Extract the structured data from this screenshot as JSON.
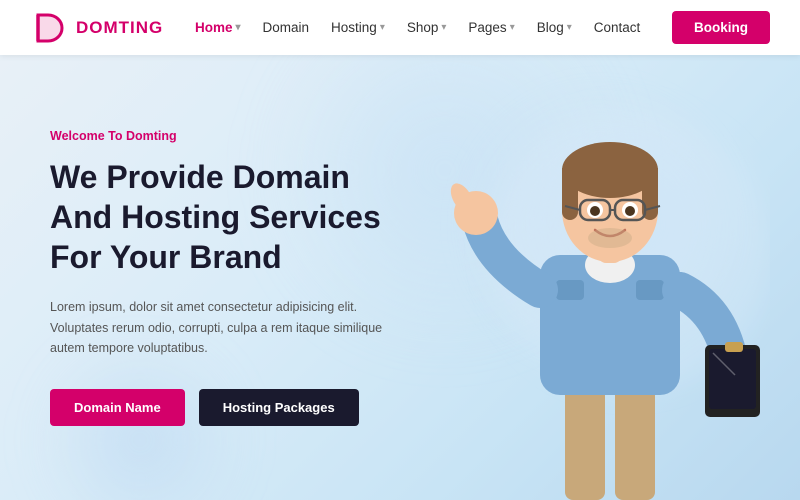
{
  "navbar": {
    "logo_text": "DOMTING",
    "nav_items": [
      {
        "label": "Home",
        "has_dropdown": true,
        "active": true
      },
      {
        "label": "Domain",
        "has_dropdown": false,
        "active": false
      },
      {
        "label": "Hosting",
        "has_dropdown": true,
        "active": false
      },
      {
        "label": "Shop",
        "has_dropdown": true,
        "active": false
      },
      {
        "label": "Pages",
        "has_dropdown": true,
        "active": false
      },
      {
        "label": "Blog",
        "has_dropdown": true,
        "active": false
      },
      {
        "label": "Contact",
        "has_dropdown": false,
        "active": false
      }
    ],
    "booking_label": "Booking"
  },
  "hero": {
    "welcome_label": "Welcome To Domting",
    "title_line1": "We Provide Domain",
    "title_line2": "And Hosting Services",
    "title_line3": "For Your Brand",
    "description": "Lorem ipsum, dolor sit amet consectetur adipisicing elit. Voluptates rerum odio, corrupti, culpa a rem itaque similique autem tempore voluptatibus.",
    "btn_domain": "Domain Name",
    "btn_hosting": "Hosting Packages"
  },
  "colors": {
    "brand_pink": "#d4006a",
    "brand_dark": "#1a1a2e",
    "text_body": "#555555",
    "bg_hero": "#daeaf5"
  }
}
